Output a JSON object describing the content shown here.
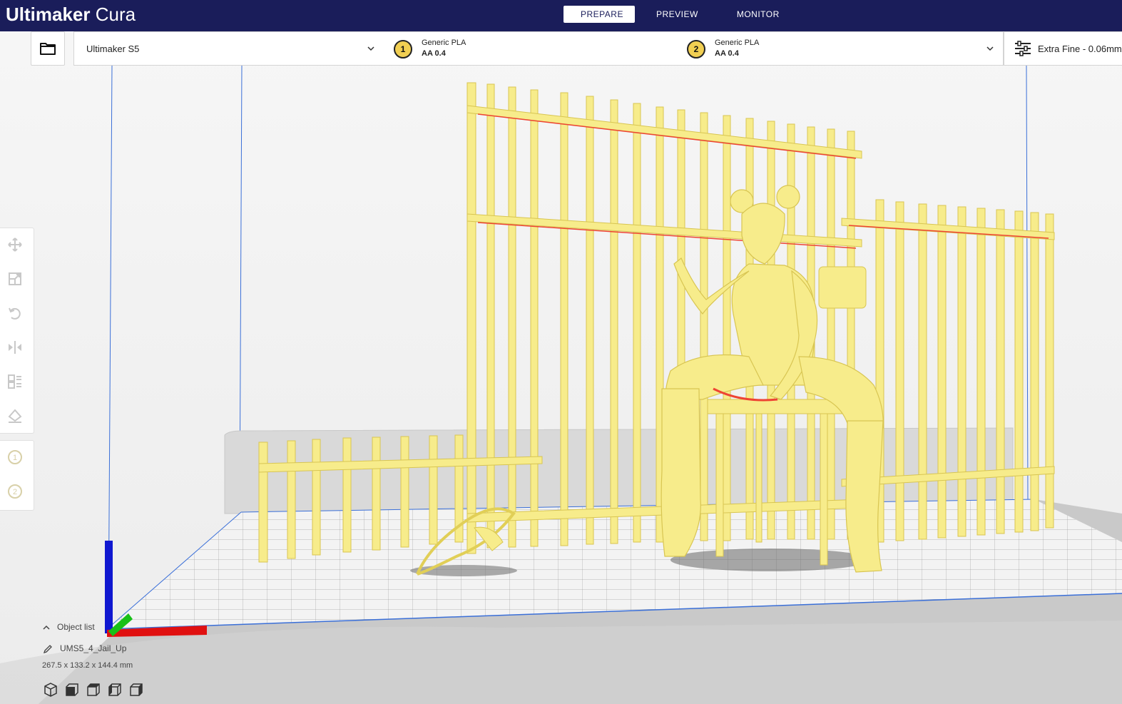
{
  "app": {
    "brand_bold": "Ultimaker",
    "brand_light": "Cura"
  },
  "stages": [
    {
      "label": "PREPARE",
      "active": true
    },
    {
      "label": "PREVIEW",
      "active": false
    },
    {
      "label": "MONITOR",
      "active": false
    }
  ],
  "toolbar": {
    "open_icon": "folder-icon",
    "printer": "Ultimaker S5",
    "extruders": [
      {
        "number": "1",
        "material": "Generic PLA",
        "nozzle": "AA 0.4"
      },
      {
        "number": "2",
        "material": "Generic PLA",
        "nozzle": "AA 0.4"
      }
    ],
    "profile": "Extra Fine - 0.06mm"
  },
  "left_tools": [
    {
      "name": "move-icon"
    },
    {
      "name": "scale-icon"
    },
    {
      "name": "rotate-icon"
    },
    {
      "name": "mirror-icon"
    },
    {
      "name": "per-model-settings-icon"
    },
    {
      "name": "support-blocker-icon"
    }
  ],
  "extruder_tools": [
    {
      "label": "1"
    },
    {
      "label": "2"
    }
  ],
  "object_list": {
    "toggle_label": "Object list",
    "object_name": "UMS5_4_Jail_Up",
    "dimensions": "267.5 x 133.2 x 144.4 mm"
  },
  "view_buttons": [
    {
      "name": "3d-view-icon"
    },
    {
      "name": "front-view-icon"
    },
    {
      "name": "top-view-icon"
    },
    {
      "name": "left-view-icon"
    },
    {
      "name": "right-view-icon"
    }
  ],
  "colors": {
    "header": "#1a1d5a",
    "model": "#f7ec8b",
    "model_shade": "#e1cf57",
    "build_plate": "#cfcfcf",
    "axis_x": "#e01010",
    "axis_y": "#18c018",
    "axis_z": "#1018d0"
  }
}
